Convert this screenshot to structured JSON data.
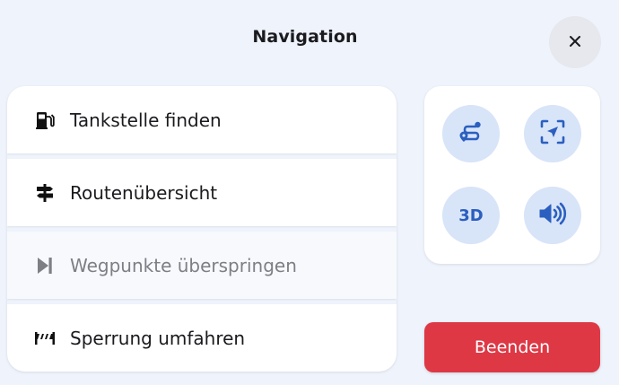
{
  "header": {
    "title": "Navigation",
    "close_icon": "close-icon"
  },
  "menu": {
    "items": [
      {
        "label": "Tankstelle finden",
        "icon": "fuel-pump-icon",
        "enabled": true
      },
      {
        "label": "Routenübersicht",
        "icon": "signpost-icon",
        "enabled": true
      },
      {
        "label": "Wegpunkte überspringen",
        "icon": "skip-next-icon",
        "enabled": false
      },
      {
        "label": "Sperrung umfahren",
        "icon": "road-barrier-icon",
        "enabled": true
      }
    ]
  },
  "quick_actions": {
    "route": {
      "icon": "route-icon"
    },
    "recenter": {
      "icon": "recenter-location-icon"
    },
    "view3d": {
      "label": "3D"
    },
    "sound": {
      "icon": "volume-icon"
    }
  },
  "footer": {
    "end_label": "Beenden"
  },
  "colors": {
    "background": "#eff3fc",
    "accent_blue": "#2b5fbf",
    "quick_button_bg": "#d8e4f8",
    "danger": "#de3845"
  }
}
